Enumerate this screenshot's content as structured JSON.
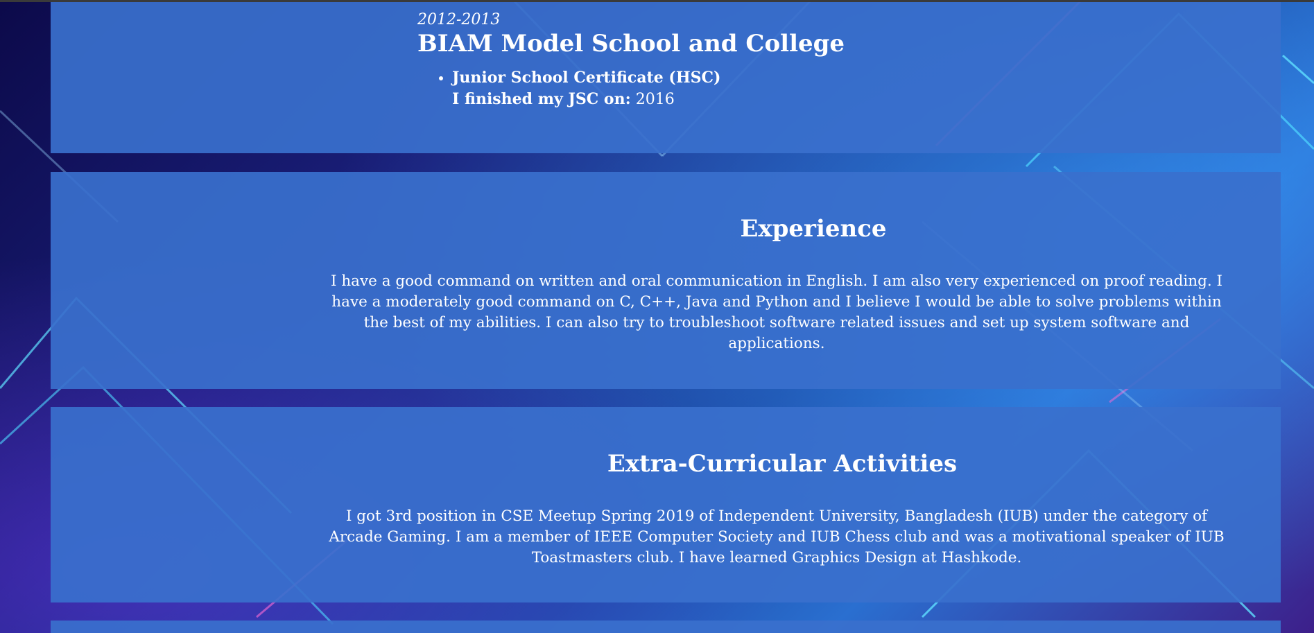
{
  "education": {
    "years": "2012-2013",
    "school": "BIAM Model School and College",
    "items": [
      {
        "title": "Junior School Certificate (HSC)",
        "detail_label": "I finished my JSC on:",
        "detail_value": "2016"
      }
    ]
  },
  "experience": {
    "title": "Experience",
    "text": "I have a good command on written and oral communication in English. I am also very experienced on proof reading. I have a moderately good command on C, C++, Java and Python and I believe I would be able to solve problems within the best of my abilities. I can also try to troubleshoot software related issues and set up system software and applications."
  },
  "extra_curricular": {
    "title": "Extra-Curricular Activities",
    "text": "I got 3rd position in CSE Meetup Spring 2019 of Independent University, Bangladesh (IUB) under the category of Arcade Gaming. I am a member of IEEE Computer Society and IUB Chess club and was a motivational speaker of IUB Toastmasters club. I have learned Graphics Design at Hashkode."
  },
  "colors": {
    "panel": "#3a70cd",
    "background_dark": "#0c0a4a",
    "background_accent": "#2a6fd0",
    "neon_cyan": "#5fe0ff",
    "neon_magenta": "#e060ff"
  }
}
